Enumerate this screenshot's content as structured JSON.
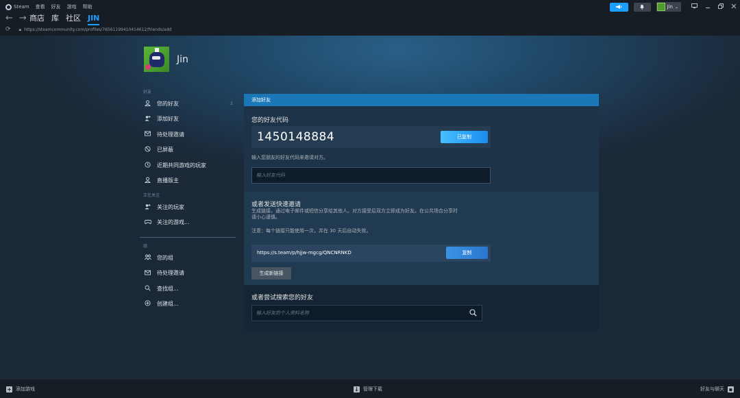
{
  "menu": {
    "app_name": "Steam",
    "items": [
      "查看",
      "好友",
      "游戏",
      "帮助"
    ]
  },
  "titlebar": {
    "username": "Jin",
    "icons": [
      "announcement-icon",
      "bell-icon",
      "monitor-icon",
      "minimize-icon",
      "restore-icon",
      "close-icon"
    ]
  },
  "nav": {
    "links": [
      "商店",
      "库",
      "社区",
      "JIN"
    ],
    "active": "JIN",
    "url": "https://steamcommunity.com/profiles/76561199410414612/friends/add"
  },
  "profile": {
    "name": "Jin"
  },
  "sidebar": {
    "friends_header": "好友",
    "friends_items": [
      {
        "label": "您的好友",
        "icon": "person-icon",
        "count": "2"
      },
      {
        "label": "添加好友",
        "icon": "add-person-icon"
      },
      {
        "label": "待处理邀请",
        "icon": "envelope-icon"
      },
      {
        "label": "已屏蔽",
        "icon": "blocked-icon"
      },
      {
        "label": "近期共同游戏的玩家",
        "icon": "clock-icon"
      },
      {
        "label": "直播版主",
        "icon": "person-icon"
      }
    ],
    "following_header": "正在关注",
    "following_items": [
      {
        "label": "关注的玩家",
        "icon": "add-person-icon"
      },
      {
        "label": "关注的游戏...",
        "icon": "gamepad-icon"
      }
    ],
    "groups_header": "组",
    "groups_items": [
      {
        "label": "您的组",
        "icon": "group-icon"
      },
      {
        "label": "待处理邀请",
        "icon": "envelope-icon"
      },
      {
        "label": "查找组...",
        "icon": "search-icon"
      },
      {
        "label": "创建组...",
        "icon": "plus-circle-icon"
      }
    ]
  },
  "panel": {
    "header": "添加好友",
    "code_section": {
      "title": "您的好友代码",
      "code": "1450148884",
      "copied_label": "已复制",
      "hint": "输入您朋友的好友代码来邀请对方。",
      "input_placeholder": "输入好友代码"
    },
    "invite_section": {
      "title": "或者发送快速邀请",
      "desc_line1": "生成链接，通过电子邮件或短信分享给其他人。对方接受后双方立即成为好友。在公共场合分享时",
      "desc_line2": "请小心谨慎。",
      "note": "注意：每个链接只能使用一次，并在 30 天后自动失效。",
      "link": "https://s.team/p/hjjw-mgcg/QNCNRNKD",
      "copy_label": "复制",
      "generate_label": "生成新链接"
    },
    "search_section": {
      "title": "或者尝试搜索您的好友",
      "placeholder": "输入好友的个人资料名称"
    }
  },
  "bottombar": {
    "add_game": "添加游戏",
    "manage_downloads": "管理下载",
    "friends_chat": "好友与聊天"
  },
  "colors": {
    "accent": "#1a9fff",
    "panel_header": "#1a78b8",
    "background": "#1b2838"
  }
}
